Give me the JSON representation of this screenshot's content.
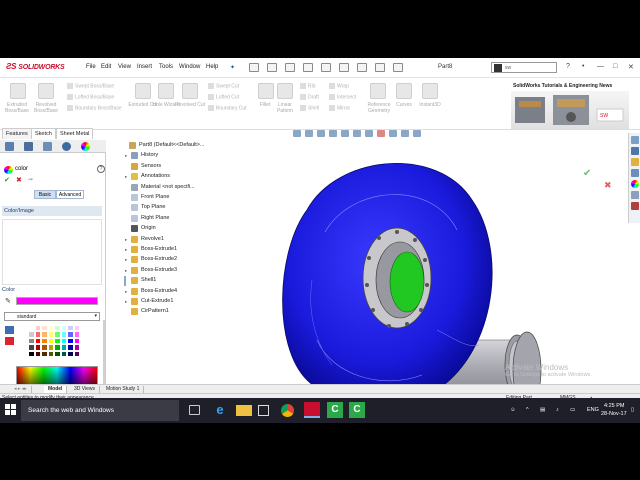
{
  "app": {
    "name": "SOLIDWORKS",
    "document_title": "Part8",
    "search_placeholder": "sw",
    "menus": [
      "File",
      "Edit",
      "View",
      "Insert",
      "Tools",
      "Window",
      "Help"
    ]
  },
  "ribbon": {
    "big_buttons": [
      {
        "label": "Extruded Boss/Base"
      },
      {
        "label": "Revolved Boss/Base"
      },
      {
        "label": "Extruded Cut"
      },
      {
        "label": "Hole Wizard"
      },
      {
        "label": "Revolved Cut"
      },
      {
        "label": "Fillet"
      },
      {
        "label": "Linear Pattern"
      },
      {
        "label": "Reference Geometry"
      },
      {
        "label": "Curves"
      },
      {
        "label": "Instant3D"
      }
    ],
    "small_buttons": [
      "Swept Boss/Base",
      "Lofted Boss/Base",
      "Boundary Boss/Base",
      "Swept Cut",
      "Lofted Cut",
      "Boundary Cut",
      "Rib",
      "Draft",
      "Shell",
      "Wrap",
      "Intersect",
      "Mirror"
    ],
    "news_title": "SolidWorks Tutorials & Engineering News"
  },
  "command_tabs": [
    "Features",
    "Sketch",
    "Sheet Metal"
  ],
  "property_manager": {
    "title": "color",
    "help": "?",
    "pin": "⇾",
    "mode_buttons": [
      "Basic",
      "Advanced"
    ],
    "section_color_image": "Color/Image",
    "section_color": "Color",
    "palette_name": "standard",
    "current_color": "#ff00ff",
    "rgb_values": [
      {
        "value": "0",
        "color": "#e02020"
      },
      {
        "value": "255",
        "color": "#20c020"
      }
    ],
    "palette_colors": [
      "#ffffff",
      "#ffcccc",
      "#ffe0cc",
      "#ffffcc",
      "#ccffcc",
      "#ccffff",
      "#ccccff",
      "#ffccff",
      "#cccccc",
      "#ff6666",
      "#ffb366",
      "#ffff66",
      "#66ff66",
      "#66ffff",
      "#6666ff",
      "#ff66ff",
      "#888888",
      "#ff0000",
      "#ff8000",
      "#ffff00",
      "#00ff00",
      "#00ffff",
      "#0000ff",
      "#ff00ff",
      "#444444",
      "#aa0000",
      "#aa5500",
      "#aaaa00",
      "#00aa00",
      "#00aaaa",
      "#0000aa",
      "#aa00aa",
      "#000000",
      "#550000",
      "#552a00",
      "#555500",
      "#005500",
      "#005555",
      "#000055",
      "#550055"
    ]
  },
  "feature_tree": [
    {
      "label": "Part8  (Default<<Default>...",
      "toggle": "",
      "icon_color": "#c9a45a",
      "indent": 0
    },
    {
      "label": "History",
      "toggle": "▸",
      "icon_color": "#8aa0bb",
      "indent": 1
    },
    {
      "label": "Sensors",
      "toggle": "",
      "icon_color": "#d8a640",
      "indent": 1
    },
    {
      "label": "Annotations",
      "toggle": "▸",
      "icon_color": "#e0c040",
      "indent": 1
    },
    {
      "label": "Material <not specifi...",
      "toggle": "",
      "icon_color": "#9aa6b4",
      "indent": 1
    },
    {
      "label": "Front Plane",
      "toggle": "",
      "icon_color": "#b8c6d8",
      "indent": 1
    },
    {
      "label": "Top Plane",
      "toggle": "",
      "icon_color": "#b8c6d8",
      "indent": 1
    },
    {
      "label": "Right Plane",
      "toggle": "",
      "icon_color": "#b8c6d8",
      "indent": 1
    },
    {
      "label": "Origin",
      "toggle": "",
      "icon_color": "#555555",
      "indent": 1
    },
    {
      "label": "Revolve1",
      "toggle": "▸",
      "icon_color": "#e0b040",
      "indent": 1
    },
    {
      "label": "Boss-Extrude1",
      "toggle": "▸",
      "icon_color": "#e0b040",
      "indent": 1
    },
    {
      "label": "Boss-Extrude2",
      "toggle": "▸",
      "icon_color": "#e0b040",
      "indent": 1
    },
    {
      "label": "Boss-Extrude3",
      "toggle": "▸",
      "icon_color": "#e0b040",
      "indent": 1
    },
    {
      "label": "Shell1",
      "toggle": "",
      "icon_color": "#e0b040",
      "indent": 1,
      "selected": true
    },
    {
      "label": "Boss-Extrude4",
      "toggle": "▸",
      "icon_color": "#e0b040",
      "indent": 1
    },
    {
      "label": "Cut-Extrude1",
      "toggle": "▸",
      "icon_color": "#e0b040",
      "indent": 1
    },
    {
      "label": "CirPattern1",
      "toggle": "",
      "icon_color": "#e0b040",
      "indent": 1
    }
  ],
  "bottom_tabs": [
    "Model",
    "3D Views",
    "Motion Study 1"
  ],
  "status": {
    "message": "Select entities to modify their appearance",
    "mode": "Editing Part",
    "units": "MMGS"
  },
  "watermark": {
    "line1": "Activate Windows",
    "line2": "Go to Settings to activate Windows."
  },
  "taskbar": {
    "search_text": "Search the web and Windows",
    "tray": "ENG",
    "time": "4:25 PM",
    "date": "28-Nov-17"
  },
  "colors": {
    "part_body": "#1a1adc",
    "selected_face": "#22c822",
    "flange": "#c8c8cc",
    "pipe": "#b0b0b8",
    "brand_red": "#c8102e"
  }
}
